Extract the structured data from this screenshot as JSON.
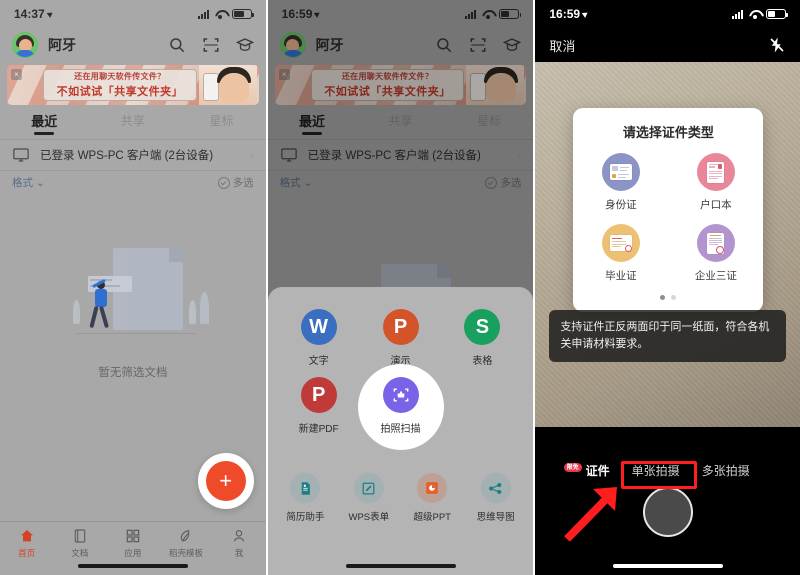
{
  "panels": [
    {
      "id": "home-filtered",
      "status": {
        "time": "14:37",
        "signal": "signal-icon",
        "wifi": "wifi-icon",
        "battery": "battery-icon"
      },
      "header": {
        "username": "阿牙",
        "search": "search-icon",
        "scan": "scan-icon",
        "graduation": "graduation-cap-icon"
      },
      "banner": {
        "line1": "还在用聊天软件传文件？",
        "line2": "不如试试「共享文件夹」",
        "close": "close-icon"
      },
      "tabs": [
        {
          "label": "最近",
          "active": true
        },
        {
          "label": "共享",
          "active": false
        },
        {
          "label": "星标",
          "active": false
        }
      ],
      "device_row": {
        "label": "已登录 WPS-PC 客户端 (2台设备)",
        "icon": "monitor-icon",
        "chevron": "chevron-right-icon"
      },
      "filter_bar": {
        "format_label": "格式",
        "chevron": "chevron-down-icon",
        "multi_label": "多选",
        "check": "check-circle-icon"
      },
      "empty_state": {
        "text": "暂无筛选文档",
        "illustration": "empty-document-illustration"
      },
      "fab": {
        "label": "+",
        "color": "#ef4a2a"
      },
      "bottom_nav": [
        {
          "label": "首页",
          "icon": "home-icon",
          "active": true
        },
        {
          "label": "文档",
          "icon": "document-icon",
          "active": false
        },
        {
          "label": "应用",
          "icon": "apps-grid-icon",
          "active": false
        },
        {
          "label": "稻壳模板",
          "icon": "template-icon",
          "active": false
        },
        {
          "label": "我",
          "icon": "user-icon",
          "active": false
        }
      ]
    },
    {
      "id": "create-sheet",
      "status": {
        "time": "16:59"
      },
      "header": {
        "username": "阿牙"
      },
      "banner": {
        "line1": "还在用聊天软件传文件？",
        "line2": "不如试试「共享文件夹」"
      },
      "tabs": [
        {
          "label": "最近",
          "active": true
        },
        {
          "label": "共享",
          "active": false
        },
        {
          "label": "星标",
          "active": false
        }
      ],
      "device_row": {
        "label": "已登录 WPS-PC 客户端 (2台设备)"
      },
      "filter_bar": {
        "format_label": "格式",
        "multi_label": "多选"
      },
      "sheet": {
        "items": [
          {
            "label": "文字",
            "glyph": "W",
            "color": "#3a6ec0",
            "highlight": false
          },
          {
            "label": "演示",
            "glyph": "P",
            "color": "#d4542a",
            "highlight": false
          },
          {
            "label": "表格",
            "glyph": "S",
            "color": "#17a05e",
            "highlight": false
          },
          {
            "label": "新建PDF",
            "glyph": "P",
            "color": "#c03a3a",
            "highlight": false
          },
          {
            "label": "拍照扫描",
            "glyph": "scan-frame-icon",
            "color": "#7b63e8",
            "highlight": true
          }
        ],
        "tools": [
          {
            "label": "简历助手",
            "icon": "resume-icon",
            "color": "#1f7f82"
          },
          {
            "label": "WPS表单",
            "icon": "form-edit-icon",
            "color": "#1f7f82"
          },
          {
            "label": "超级PPT",
            "icon": "ppt-icon",
            "color": "#e2612a"
          },
          {
            "label": "思维导图",
            "icon": "mindmap-icon",
            "color": "#1f7f82"
          }
        ]
      }
    },
    {
      "id": "camera-id-scan",
      "status": {
        "time": "16:59"
      },
      "camera_header": {
        "cancel": "取消",
        "flash": "flash-off-icon"
      },
      "dialog": {
        "title": "请选择证件类型",
        "options": [
          {
            "label": "身份证",
            "color": "#8b94c4",
            "icon": "id-card-icon"
          },
          {
            "label": "户口本",
            "color": "#e8879a",
            "icon": "household-register-icon"
          },
          {
            "label": "毕业证",
            "color": "#edc173",
            "icon": "diploma-icon"
          },
          {
            "label": "企业三证",
            "color": "#b295cf",
            "icon": "business-license-icon"
          }
        ],
        "pagination": {
          "total": 2,
          "current": 1
        }
      },
      "tip": "支持证件正反两面印于同一纸面，符合各机关申请材料要求。",
      "modes": [
        {
          "label": "证件",
          "active": true,
          "badge": "限免"
        },
        {
          "label": "单张拍摄",
          "active": false,
          "badge": ""
        },
        {
          "label": "多张拍摄",
          "active": false,
          "badge": ""
        }
      ],
      "shutter": "shutter-button"
    }
  ],
  "annotation": {
    "color": "#ff1d1d",
    "box": "highlight-box",
    "arrow": "pointer-arrow"
  }
}
